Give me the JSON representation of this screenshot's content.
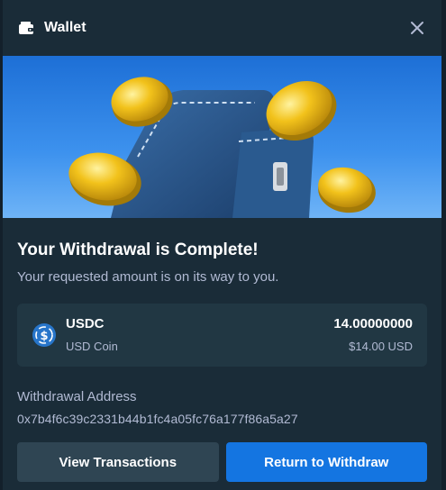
{
  "modal": {
    "title": "Wallet",
    "icon": "wallet-icon",
    "close_icon": "close-icon"
  },
  "hero": {
    "illustration": "wallet-with-gold-coins",
    "sky_color": "#3d92ee"
  },
  "status": {
    "headline": "Your Withdrawal is Complete!",
    "subline": "Your requested amount is on its way to you."
  },
  "coin": {
    "icon": "usdc-icon",
    "symbol": "USDC",
    "name": "USD Coin",
    "amount": "14.00000000",
    "usd_value": "$14.00 USD",
    "brand_color": "#2775ca"
  },
  "withdrawal": {
    "address_label": "Withdrawal Address",
    "address": "0x7b4f6c39c2331b44b1fc4a05fc76a177f86a5a27"
  },
  "buttons": {
    "view_transactions": "View Transactions",
    "return_to_withdraw": "Return to Withdraw"
  },
  "colors": {
    "panel_bg": "#1a2c38",
    "card_bg": "#213743",
    "secondary_button": "#2f4553",
    "primary_button": "#1475e1",
    "muted_text": "#b1bad3"
  }
}
